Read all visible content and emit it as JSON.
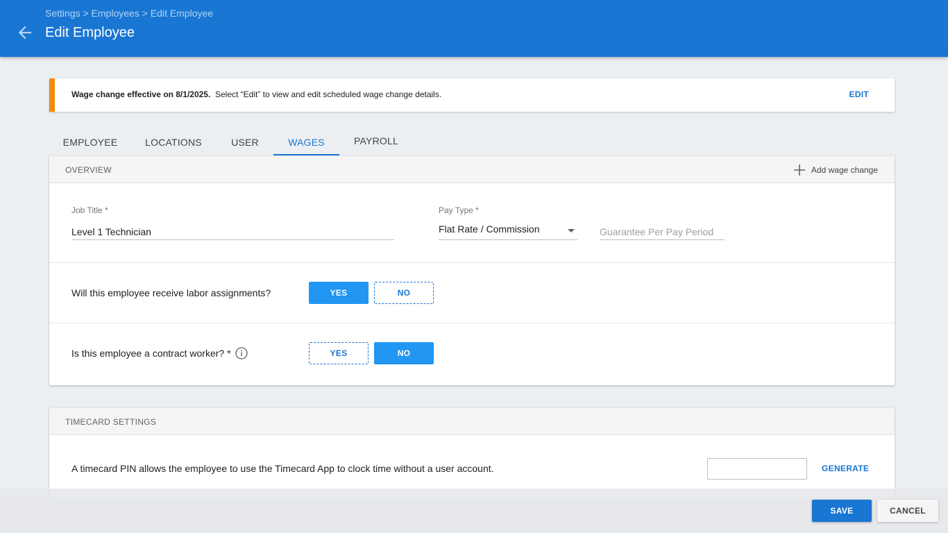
{
  "header": {
    "breadcrumb": "Settings > Employees > Edit  Employee",
    "title": "Edit Employee",
    "back_icon": "arrow-left-icon"
  },
  "banner": {
    "bold_text": "Wage change effective on 8/1/2025.",
    "text": "Select “Edit” to view and edit scheduled wage change details.",
    "edit_label": "EDIT",
    "accent_color": "#ef8c10"
  },
  "tabs": [
    {
      "label": "EMPLOYEE",
      "active": false
    },
    {
      "label": "LOCATIONS",
      "active": false
    },
    {
      "label": "USER",
      "active": false
    },
    {
      "label": "WAGES",
      "active": true
    },
    {
      "label": "PAYROLL",
      "active": false
    }
  ],
  "overview": {
    "title": "OVERVIEW",
    "add_wage_label": "Add wage change",
    "job_title_label": "Job Title *",
    "job_title_value": "Level 1 Technician",
    "pay_type_label": "Pay Type *",
    "pay_type_value": "Flat Rate / Commission",
    "guarantee_placeholder": "Guarantee Per Pay Period",
    "labor_question": "Will this employee receive labor assignments?",
    "labor_yes": "YES",
    "labor_no": "NO",
    "labor_selected": "YES",
    "contract_question": "Is this employee a contract worker? *",
    "contract_yes": "YES",
    "contract_no": "NO",
    "contract_selected": "NO"
  },
  "timecard": {
    "title": "TIMECARD SETTINGS",
    "description": "A timecard PIN allows the employee to use the Timecard App to clock time without a user account.",
    "pin_value": "",
    "generate_label": "GENERATE"
  },
  "footer": {
    "save_label": "SAVE",
    "cancel_label": "CANCEL"
  },
  "colors": {
    "primary": "#1976d2",
    "toggle_on": "#2196f3"
  }
}
